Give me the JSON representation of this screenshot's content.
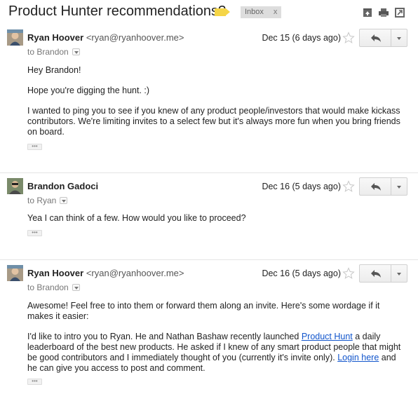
{
  "thread": {
    "subject": "Product Hunter recommendations?",
    "label": "Inbox",
    "label_close": "x",
    "label_color": "#f5d547"
  },
  "toolbar_icons": [
    "archive-icon",
    "print-icon",
    "new-window-icon"
  ],
  "messages": [
    {
      "sender_name": "Ryan Hoover",
      "sender_email": "<ryan@ryanhoover.me>",
      "to": "to Brandon",
      "date": "Dec 15 (6 days ago)",
      "paragraphs": [
        "Hey Brandon!",
        "Hope you're digging the hunt. :)",
        "I wanted to ping you to see if you knew of any product people/investors that would make kickass contributors.  We're limiting invites to a select few but it's always more fun when you bring friends on board."
      ],
      "trimmed": "•••"
    },
    {
      "sender_name": "Brandon Gadoci",
      "sender_email": "",
      "to": "to Ryan",
      "date": "Dec 16 (5 days ago)",
      "paragraphs": [
        "Yea I can think of a few. How would you like to proceed?"
      ],
      "trimmed": "•••"
    },
    {
      "sender_name": "Ryan Hoover",
      "sender_email": "<ryan@ryanhoover.me>",
      "to": "to Brandon",
      "date": "Dec 16 (5 days ago)",
      "p1": "Awesome!  Feel free to into them or forward them along an invite.  Here's some wordage if it makes it easier:",
      "p2_a": "I'd like to intro you to Ryan.  He and Nathan Bashaw recently launched ",
      "p2_link1": "Product Hunt",
      "p2_b": " a daily leaderboard of the best new products.  He asked if I knew of any smart product people that might be good contributors and I immediately thought of you (currently it's invite only).  ",
      "p2_link2": "Login here",
      "p2_c": " and he can give you access to post and comment.",
      "trimmed": "•••"
    }
  ],
  "colors": {
    "link": "#1155cc",
    "label_bg": "#dddddd"
  }
}
